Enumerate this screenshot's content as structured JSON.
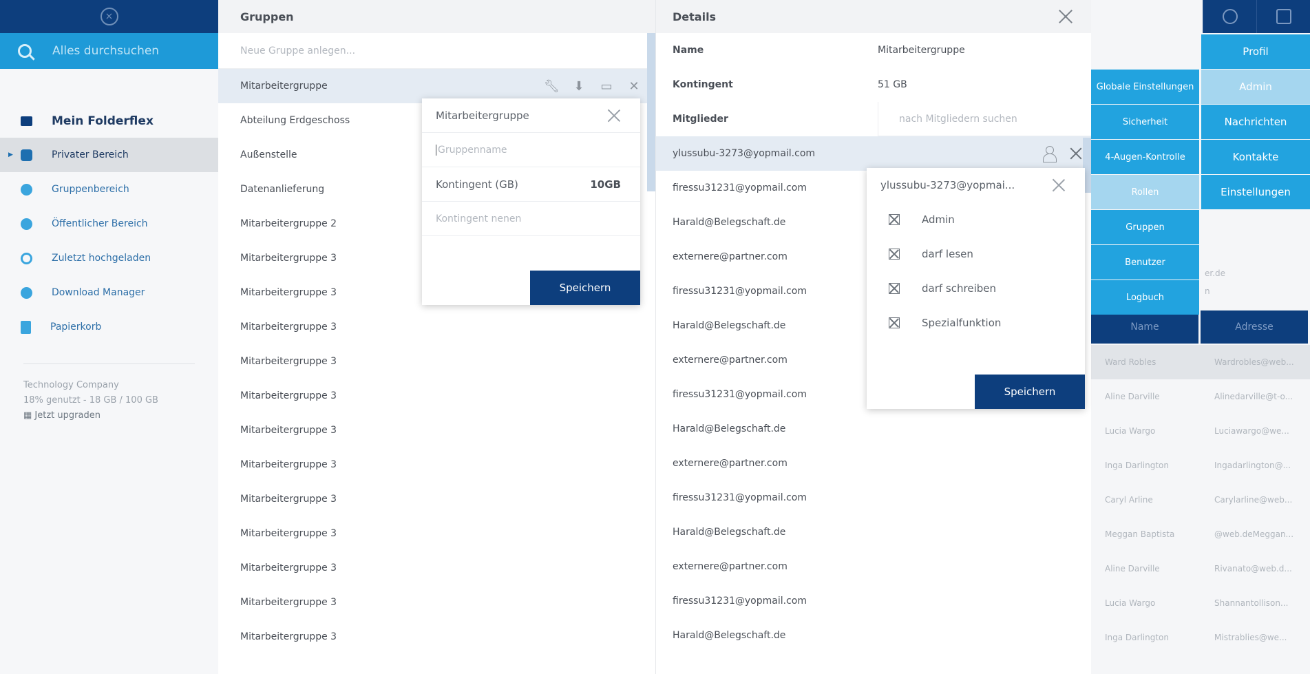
{
  "sidebar": {
    "search_placeholder": "Alles durchsuchen",
    "main_title": "Mein Folderflex",
    "items": [
      {
        "label": "Privater Bereich"
      },
      {
        "label": "Gruppenbereich"
      },
      {
        "label": "Öffentlicher Bereich"
      },
      {
        "label": "Zuletzt hochgeladen"
      },
      {
        "label": "Download Manager"
      },
      {
        "label": "Papierkorb"
      }
    ],
    "company": "Technology Company",
    "usage": "18% genutzt - 18 GB / 100 GB",
    "upgrade": "Jetzt upgraden"
  },
  "gruppen": {
    "title": "Gruppen",
    "new_placeholder": "Neue Gruppe anlegen...",
    "items": [
      "Mitarbeitergruppe",
      "Abteilung Erdgeschoss",
      "Außenstelle",
      "Datenanlieferung",
      "Mitarbeitergruppe 2",
      "Mitarbeitergruppe 3",
      "Mitarbeitergruppe 3",
      "Mitarbeitergruppe 3",
      "Mitarbeitergruppe 3",
      "Mitarbeitergruppe 3",
      "Mitarbeitergruppe 3",
      "Mitarbeitergruppe 3",
      "Mitarbeitergruppe 3",
      "Mitarbeitergruppe 3",
      "Mitarbeitergruppe 3",
      "Mitarbeitergruppe 3",
      "Mitarbeitergruppe 3"
    ]
  },
  "edit_group": {
    "title": "Mitarbeitergruppe",
    "name_placeholder": "Gruppenname",
    "quota_label": "Kontingent (GB)",
    "quota_value": "10GB",
    "quota_placeholder": "Kontingent nenen",
    "save": "Speichern"
  },
  "details": {
    "title": "Details",
    "name_label": "Name",
    "name_value": "Mitarbeitergruppe",
    "quota_label": "Kontingent",
    "quota_value": "51 GB",
    "members_label": "Mitglieder",
    "members_search": "nach Mitgliedern suchen",
    "members": [
      "ylussubu-3273@yopmail.com",
      "firessu31231@yopmail.com",
      "Harald@Belegschaft.de",
      "externere@partner.com",
      "firessu31231@yopmail.com",
      "Harald@Belegschaft.de",
      "externere@partner.com",
      "firessu31231@yopmail.com",
      "Harald@Belegschaft.de",
      "externere@partner.com",
      "firessu31231@yopmail.com",
      "Harald@Belegschaft.de",
      "externere@partner.com",
      "firessu31231@yopmail.com",
      "Harald@Belegschaft.de"
    ]
  },
  "permissions": {
    "title": "ylussubu-3273@yopmai...",
    "items": [
      "Admin",
      "darf lesen",
      "darf schreiben",
      "Spezialfunktion"
    ],
    "save": "Speichern"
  },
  "admin_nav": {
    "left": [
      "Globale Einstellungen",
      "Sicherheit",
      "4-Augen-Kontrolle",
      "Rollen",
      "Gruppen",
      "Benutzer",
      "Logbuch"
    ],
    "right": [
      "Profil",
      "Admin",
      "Nachrichten",
      "Kontakte",
      "Einstellungen"
    ]
  },
  "background_table": {
    "col_name": "Name",
    "col_address": "Adresse",
    "ghost_1": "er.de",
    "ghost_2": "n",
    "rows": [
      [
        "Ward Robles",
        "Wardrobles@web..."
      ],
      [
        "Aline Darville",
        "Alinedarville@t-o..."
      ],
      [
        "Lucia Wargo",
        "Luciawargo@we..."
      ],
      [
        "Inga Darlington",
        "Ingadarlington@..."
      ],
      [
        "Caryl Arline",
        "Carylarline@web..."
      ],
      [
        "Meggan Baptista",
        "@web.deMeggan..."
      ],
      [
        "Aline Darville",
        "Rivanato@web.d..."
      ],
      [
        "Lucia Wargo",
        "Shannantollison..."
      ],
      [
        "Inga Darlington",
        "Mistrablies@we..."
      ]
    ]
  },
  "colors": {
    "navy": "#0d3e7d",
    "accent": "#22a3df",
    "accent_light": "#a5d6ef",
    "selected_row": "#e4ebf3"
  }
}
